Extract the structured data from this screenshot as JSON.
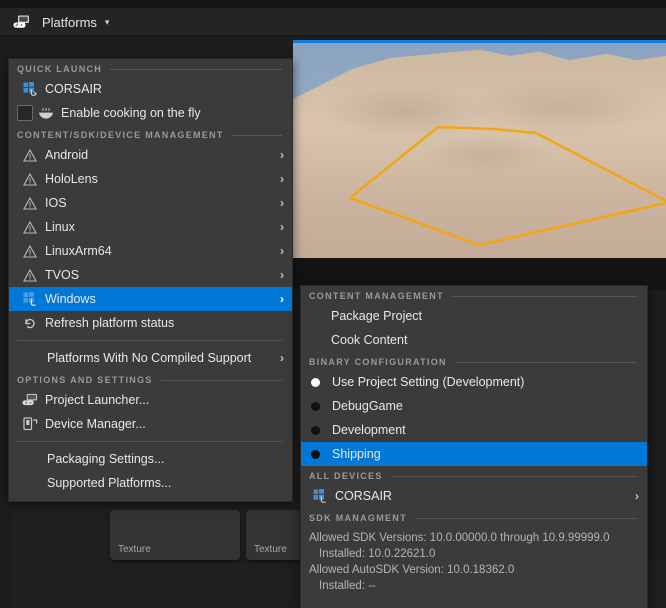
{
  "toolbar": {
    "platforms_button": "Platforms",
    "platforms_icon": "gamepad-monitor-icon",
    "chevron": "⌄"
  },
  "viewport": {
    "scene": "desert-dune-landscape",
    "selection_outline_color": "#f2a615",
    "sky_color": "#8ba3c0",
    "sand_color": "#d4c0a8"
  },
  "content_browser": {
    "tiles": [
      {
        "label": "Texture"
      },
      {
        "label": "Texture"
      }
    ]
  },
  "main_menu": {
    "sections": [
      {
        "id": "quick-launch",
        "title": "QUICK LAUNCH",
        "items": [
          {
            "id": "corsair",
            "label": "CORSAIR",
            "icon": "windows-device-icon",
            "type": "item"
          },
          {
            "id": "enable-cooking",
            "label": "Enable cooking on the fly",
            "icon": "cooking-bowl-icon",
            "type": "checkbox",
            "checked": false
          }
        ]
      },
      {
        "id": "content-sdk-device-management",
        "title": "CONTENT/SDK/DEVICE MANAGEMENT",
        "items": [
          {
            "id": "android",
            "label": "Android",
            "icon": "warning-triangle-icon",
            "type": "submenu"
          },
          {
            "id": "hololens",
            "label": "HoloLens",
            "icon": "warning-triangle-icon",
            "type": "submenu"
          },
          {
            "id": "ios",
            "label": "IOS",
            "icon": "warning-triangle-icon",
            "type": "submenu"
          },
          {
            "id": "linux",
            "label": "Linux",
            "icon": "warning-triangle-icon",
            "type": "submenu"
          },
          {
            "id": "linuxarm64",
            "label": "LinuxArm64",
            "icon": "warning-triangle-icon",
            "type": "submenu"
          },
          {
            "id": "tvos",
            "label": "TVOS",
            "icon": "warning-triangle-icon",
            "type": "submenu"
          },
          {
            "id": "windows",
            "label": "Windows",
            "icon": "windows-logo-icon",
            "type": "submenu",
            "selected": true
          },
          {
            "id": "refresh-platform-status",
            "label": "Refresh platform status",
            "icon": "refresh-icon",
            "type": "item"
          }
        ]
      },
      {
        "id": "no-compiled-support",
        "title": "",
        "items": [
          {
            "id": "platforms-no-compiled-support",
            "label": "Platforms With No Compiled Support",
            "icon": "",
            "type": "submenu"
          }
        ]
      },
      {
        "id": "options-and-settings",
        "title": "OPTIONS AND SETTINGS",
        "items": [
          {
            "id": "project-launcher",
            "label": "Project Launcher...",
            "icon": "gamepad-monitor-icon",
            "type": "item"
          },
          {
            "id": "device-manager",
            "label": "Device Manager...",
            "icon": "device-manager-icon",
            "type": "item"
          }
        ]
      },
      {
        "id": "settings-tail",
        "title": "",
        "items": [
          {
            "id": "packaging-settings",
            "label": "Packaging Settings...",
            "icon": "",
            "type": "item"
          },
          {
            "id": "supported-platforms",
            "label": "Supported Platforms...",
            "icon": "",
            "type": "item"
          }
        ]
      }
    ]
  },
  "sub_menu": {
    "content_management": {
      "title": "CONTENT MANAGEMENT",
      "items": [
        {
          "id": "package-project",
          "label": "Package Project"
        },
        {
          "id": "cook-content",
          "label": "Cook Content"
        }
      ]
    },
    "binary_configuration": {
      "title": "BINARY CONFIGURATION",
      "items": [
        {
          "id": "use-project-setting",
          "label": "Use Project Setting (Development)",
          "checked": true,
          "selected": false
        },
        {
          "id": "debuggame",
          "label": "DebugGame",
          "checked": false,
          "selected": false
        },
        {
          "id": "development",
          "label": "Development",
          "checked": false,
          "selected": false
        },
        {
          "id": "shipping",
          "label": "Shipping",
          "checked": false,
          "selected": true
        }
      ]
    },
    "all_devices": {
      "title": "ALL DEVICES",
      "items": [
        {
          "id": "corsair-device",
          "label": "CORSAIR",
          "icon": "windows-device-icon"
        }
      ]
    },
    "sdk_management": {
      "title": "SDK MANAGMENT",
      "lines": [
        {
          "text": "Allowed SDK Versions: 10.0.00000.0 through 10.9.99999.0",
          "indent": false
        },
        {
          "text": "Installed: 10.0.22621.0",
          "indent": true
        },
        {
          "text": "Allowed AutoSDK Version: 10.0.18362.0",
          "indent": false
        },
        {
          "text": "Installed: --",
          "indent": true
        }
      ]
    }
  },
  "colors": {
    "menu_bg": "#3b3b3b",
    "highlight": "#0078d7",
    "separator": "#565656",
    "section_text": "#9a9a9a",
    "item_text": "#e8e8e8",
    "editor_bg": "#1d1d1d"
  }
}
